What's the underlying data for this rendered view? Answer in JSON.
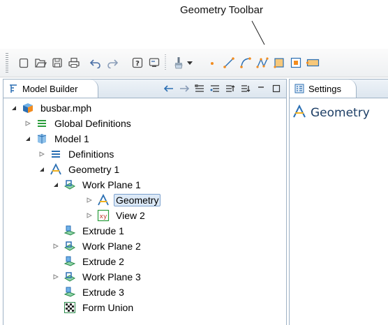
{
  "annotation": {
    "label": "Geometry Toolbar"
  },
  "toolbar": {
    "buttons": [
      {
        "name": "new-button",
        "icon": "new-file-icon"
      },
      {
        "name": "open-button",
        "icon": "open-folder-icon"
      },
      {
        "name": "save-button",
        "icon": "save-icon"
      },
      {
        "name": "print-button",
        "icon": "print-icon"
      },
      {
        "name": "undo-button",
        "icon": "undo-icon"
      },
      {
        "name": "redo-button",
        "icon": "redo-icon"
      },
      {
        "name": "help-button",
        "icon": "help-icon"
      },
      {
        "name": "monitor-button",
        "icon": "monitor-icon"
      },
      {
        "name": "build-button",
        "icon": "build-brush-icon"
      },
      {
        "name": "point-button",
        "icon": "point-icon"
      },
      {
        "name": "line-button",
        "icon": "line-icon"
      },
      {
        "name": "arc-button",
        "icon": "arc-icon"
      },
      {
        "name": "polygon-button",
        "icon": "polygon-icon"
      },
      {
        "name": "square-button",
        "icon": "square-icon"
      },
      {
        "name": "rectangle-button",
        "icon": "rectangle-icon"
      },
      {
        "name": "wide-rectangle-button",
        "icon": "wide-rectangle-icon"
      }
    ]
  },
  "model_builder": {
    "title": "Model Builder",
    "tree": [
      {
        "label": "busbar.mph",
        "icon": "mph-file-icon",
        "expander": "expanded",
        "level": 0
      },
      {
        "label": "Global Definitions",
        "icon": "definitions-icon",
        "expander": "collapsed",
        "level": 1
      },
      {
        "label": "Model 1",
        "icon": "model-icon",
        "expander": "expanded",
        "level": 1
      },
      {
        "label": "Definitions",
        "icon": "definitions-icon",
        "expander": "collapsed",
        "level": 2
      },
      {
        "label": "Geometry 1",
        "icon": "geometry-icon",
        "expander": "expanded",
        "level": 2
      },
      {
        "label": "Work Plane 1",
        "icon": "work-plane-icon",
        "expander": "expanded",
        "level": 3
      },
      {
        "label": "Geometry",
        "icon": "geometry-icon",
        "expander": "collapsed",
        "level": 4,
        "selected": true
      },
      {
        "label": "View 2",
        "icon": "xy-view-icon",
        "expander": "collapsed",
        "level": 4
      },
      {
        "label": "Extrude 1",
        "icon": "extrude-icon",
        "expander": "none",
        "level": 3
      },
      {
        "label": "Work Plane 2",
        "icon": "work-plane-icon",
        "expander": "collapsed",
        "level": 3
      },
      {
        "label": "Extrude 2",
        "icon": "extrude-icon",
        "expander": "none",
        "level": 3
      },
      {
        "label": "Work Plane 3",
        "icon": "work-plane-icon",
        "expander": "collapsed",
        "level": 3
      },
      {
        "label": "Extrude 3",
        "icon": "extrude-icon",
        "expander": "none",
        "level": 3
      },
      {
        "label": "Form Union",
        "icon": "form-union-icon",
        "expander": "none",
        "level": 3
      }
    ]
  },
  "settings": {
    "title": "Settings",
    "section_title": "Geometry"
  },
  "colors": {
    "accent_orange": "#f28c1f",
    "tree_blue": "#2b6fb3",
    "panel_border": "#9fb2c5"
  }
}
